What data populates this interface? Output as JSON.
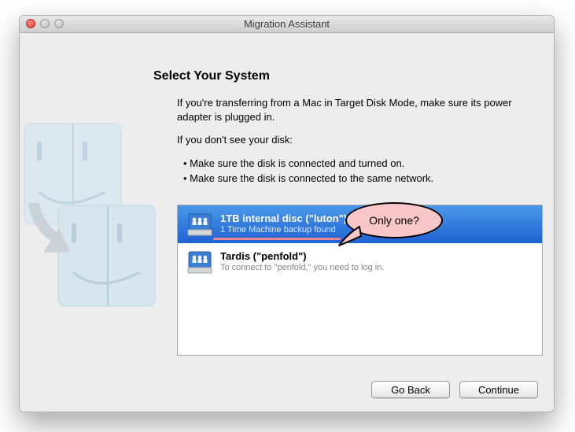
{
  "window": {
    "title": "Migration Assistant"
  },
  "heading": "Select Your System",
  "description": {
    "intro": "If you're transferring from a Mac in Target Disk Mode, make sure its power adapter is plugged in.",
    "tips_lead": "If you don't see your disk:",
    "tips": [
      "Make sure the disk is connected and turned on.",
      "Make sure the disk is connected to the same network."
    ]
  },
  "disks": [
    {
      "title": "1TB internal disc (\"luton\")",
      "subtitle": "1 Time Machine backup found",
      "selected": true
    },
    {
      "title": "Tardis (\"penfold\")",
      "subtitle": "To connect to \"penfold,\" you need to log in.",
      "selected": false
    }
  ],
  "annotation": {
    "text": "Only one?"
  },
  "buttons": {
    "go_back": "Go Back",
    "continue": "Continue"
  }
}
